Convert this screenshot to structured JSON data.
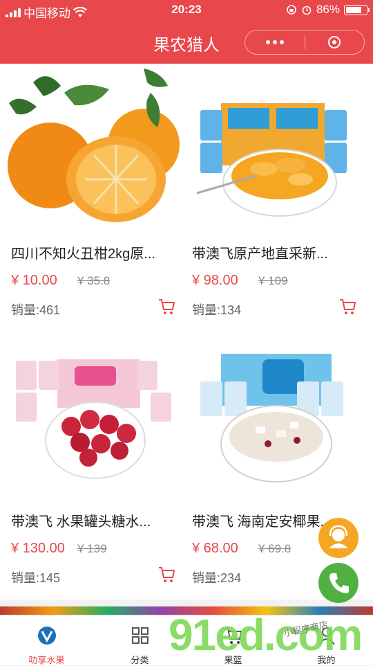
{
  "status_bar": {
    "carrier": "中国移动",
    "time": "20:23",
    "battery": "86%"
  },
  "nav": {
    "title": "果农猎人"
  },
  "products": [
    {
      "name": "四川不知火丑柑2kg原...",
      "price": "¥ 10.00",
      "original_price": "¥ 35.8",
      "sales": "销量:461",
      "image": "oranges-photo"
    },
    {
      "name": "带澳飞原产地直采新...",
      "price": "¥ 98.00",
      "original_price": "¥ 109",
      "sales": "销量:134",
      "image": "canned-orange-photo"
    },
    {
      "name": "带澳飞 水果罐头糖水...",
      "price": "¥ 130.00",
      "original_price": "¥ 139",
      "sales": "销量:145",
      "image": "canned-bayberry-photo"
    },
    {
      "name": "带澳飞 海南定安椰果...",
      "price": "¥ 68.00",
      "original_price": "¥ 69.8",
      "sales": "销量:234",
      "image": "coconut-dessert-photo"
    }
  ],
  "tabs": [
    {
      "label": "叻享水果",
      "icon": "home-logo-icon",
      "active": true
    },
    {
      "label": "分类",
      "icon": "category-grid-icon",
      "active": false
    },
    {
      "label": "果篮",
      "icon": "basket-icon",
      "active": false
    },
    {
      "label": "我的",
      "icon": "user-icon",
      "active": false
    }
  ],
  "watermark": {
    "text": "91ed.com",
    "small": "小程序商店"
  },
  "colors": {
    "brand": "#e8474b",
    "service_button": "#f5a623",
    "phone_button": "#52b043"
  }
}
